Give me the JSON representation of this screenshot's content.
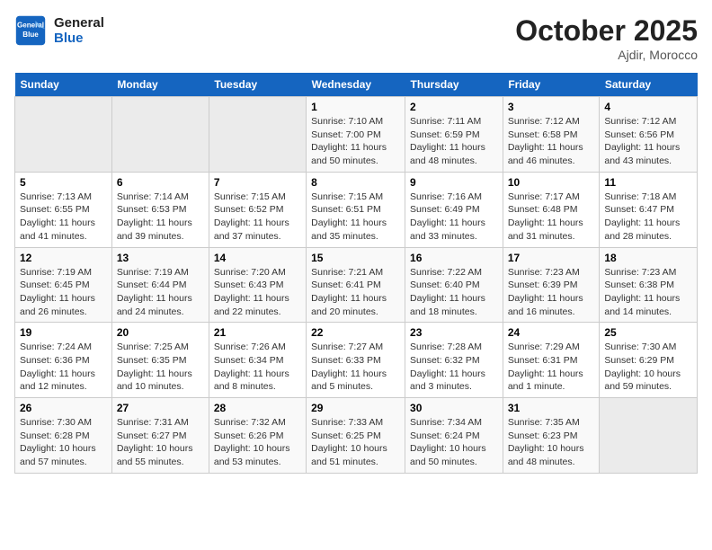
{
  "logo": {
    "line1": "General",
    "line2": "Blue"
  },
  "title": "October 2025",
  "subtitle": "Ajdir, Morocco",
  "days_of_week": [
    "Sunday",
    "Monday",
    "Tuesday",
    "Wednesday",
    "Thursday",
    "Friday",
    "Saturday"
  ],
  "weeks": [
    [
      {
        "num": "",
        "info": ""
      },
      {
        "num": "",
        "info": ""
      },
      {
        "num": "",
        "info": ""
      },
      {
        "num": "1",
        "info": "Sunrise: 7:10 AM\nSunset: 7:00 PM\nDaylight: 11 hours and 50 minutes."
      },
      {
        "num": "2",
        "info": "Sunrise: 7:11 AM\nSunset: 6:59 PM\nDaylight: 11 hours and 48 minutes."
      },
      {
        "num": "3",
        "info": "Sunrise: 7:12 AM\nSunset: 6:58 PM\nDaylight: 11 hours and 46 minutes."
      },
      {
        "num": "4",
        "info": "Sunrise: 7:12 AM\nSunset: 6:56 PM\nDaylight: 11 hours and 43 minutes."
      }
    ],
    [
      {
        "num": "5",
        "info": "Sunrise: 7:13 AM\nSunset: 6:55 PM\nDaylight: 11 hours and 41 minutes."
      },
      {
        "num": "6",
        "info": "Sunrise: 7:14 AM\nSunset: 6:53 PM\nDaylight: 11 hours and 39 minutes."
      },
      {
        "num": "7",
        "info": "Sunrise: 7:15 AM\nSunset: 6:52 PM\nDaylight: 11 hours and 37 minutes."
      },
      {
        "num": "8",
        "info": "Sunrise: 7:15 AM\nSunset: 6:51 PM\nDaylight: 11 hours and 35 minutes."
      },
      {
        "num": "9",
        "info": "Sunrise: 7:16 AM\nSunset: 6:49 PM\nDaylight: 11 hours and 33 minutes."
      },
      {
        "num": "10",
        "info": "Sunrise: 7:17 AM\nSunset: 6:48 PM\nDaylight: 11 hours and 31 minutes."
      },
      {
        "num": "11",
        "info": "Sunrise: 7:18 AM\nSunset: 6:47 PM\nDaylight: 11 hours and 28 minutes."
      }
    ],
    [
      {
        "num": "12",
        "info": "Sunrise: 7:19 AM\nSunset: 6:45 PM\nDaylight: 11 hours and 26 minutes."
      },
      {
        "num": "13",
        "info": "Sunrise: 7:19 AM\nSunset: 6:44 PM\nDaylight: 11 hours and 24 minutes."
      },
      {
        "num": "14",
        "info": "Sunrise: 7:20 AM\nSunset: 6:43 PM\nDaylight: 11 hours and 22 minutes."
      },
      {
        "num": "15",
        "info": "Sunrise: 7:21 AM\nSunset: 6:41 PM\nDaylight: 11 hours and 20 minutes."
      },
      {
        "num": "16",
        "info": "Sunrise: 7:22 AM\nSunset: 6:40 PM\nDaylight: 11 hours and 18 minutes."
      },
      {
        "num": "17",
        "info": "Sunrise: 7:23 AM\nSunset: 6:39 PM\nDaylight: 11 hours and 16 minutes."
      },
      {
        "num": "18",
        "info": "Sunrise: 7:23 AM\nSunset: 6:38 PM\nDaylight: 11 hours and 14 minutes."
      }
    ],
    [
      {
        "num": "19",
        "info": "Sunrise: 7:24 AM\nSunset: 6:36 PM\nDaylight: 11 hours and 12 minutes."
      },
      {
        "num": "20",
        "info": "Sunrise: 7:25 AM\nSunset: 6:35 PM\nDaylight: 11 hours and 10 minutes."
      },
      {
        "num": "21",
        "info": "Sunrise: 7:26 AM\nSunset: 6:34 PM\nDaylight: 11 hours and 8 minutes."
      },
      {
        "num": "22",
        "info": "Sunrise: 7:27 AM\nSunset: 6:33 PM\nDaylight: 11 hours and 5 minutes."
      },
      {
        "num": "23",
        "info": "Sunrise: 7:28 AM\nSunset: 6:32 PM\nDaylight: 11 hours and 3 minutes."
      },
      {
        "num": "24",
        "info": "Sunrise: 7:29 AM\nSunset: 6:31 PM\nDaylight: 11 hours and 1 minute."
      },
      {
        "num": "25",
        "info": "Sunrise: 7:30 AM\nSunset: 6:29 PM\nDaylight: 10 hours and 59 minutes."
      }
    ],
    [
      {
        "num": "26",
        "info": "Sunrise: 7:30 AM\nSunset: 6:28 PM\nDaylight: 10 hours and 57 minutes."
      },
      {
        "num": "27",
        "info": "Sunrise: 7:31 AM\nSunset: 6:27 PM\nDaylight: 10 hours and 55 minutes."
      },
      {
        "num": "28",
        "info": "Sunrise: 7:32 AM\nSunset: 6:26 PM\nDaylight: 10 hours and 53 minutes."
      },
      {
        "num": "29",
        "info": "Sunrise: 7:33 AM\nSunset: 6:25 PM\nDaylight: 10 hours and 51 minutes."
      },
      {
        "num": "30",
        "info": "Sunrise: 7:34 AM\nSunset: 6:24 PM\nDaylight: 10 hours and 50 minutes."
      },
      {
        "num": "31",
        "info": "Sunrise: 7:35 AM\nSunset: 6:23 PM\nDaylight: 10 hours and 48 minutes."
      },
      {
        "num": "",
        "info": ""
      }
    ]
  ]
}
